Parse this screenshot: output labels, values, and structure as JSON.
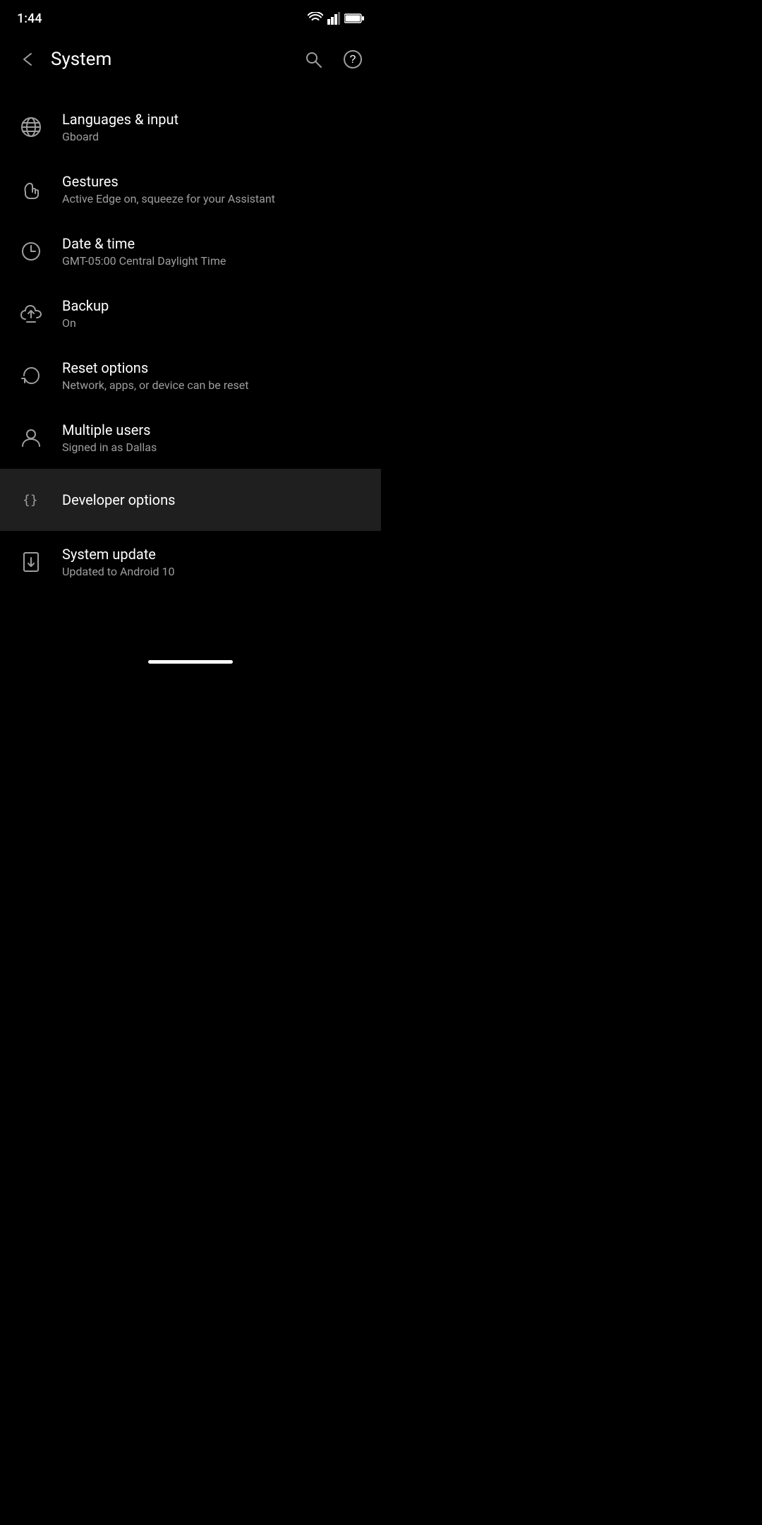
{
  "statusBar": {
    "time": "1:44",
    "wifi": "wifi",
    "signal": "signal",
    "battery": "battery"
  },
  "toolbar": {
    "title": "System",
    "backLabel": "back",
    "searchLabel": "search",
    "helpLabel": "help"
  },
  "menuItems": [
    {
      "id": "languages",
      "icon": "globe",
      "title": "Languages & input",
      "subtitle": "Gboard",
      "highlighted": false
    },
    {
      "id": "gestures",
      "icon": "gesture",
      "title": "Gestures",
      "subtitle": "Active Edge on, squeeze for your Assistant",
      "highlighted": false
    },
    {
      "id": "datetime",
      "icon": "clock",
      "title": "Date & time",
      "subtitle": "GMT-05:00 Central Daylight Time",
      "highlighted": false
    },
    {
      "id": "backup",
      "icon": "backup",
      "title": "Backup",
      "subtitle": "On",
      "highlighted": false
    },
    {
      "id": "reset",
      "icon": "reset",
      "title": "Reset options",
      "subtitle": "Network, apps, or device can be reset",
      "highlighted": false
    },
    {
      "id": "users",
      "icon": "user",
      "title": "Multiple users",
      "subtitle": "Signed in as Dallas",
      "highlighted": false
    },
    {
      "id": "developer",
      "icon": "code",
      "title": "Developer options",
      "subtitle": "",
      "highlighted": true
    },
    {
      "id": "update",
      "icon": "update",
      "title": "System update",
      "subtitle": "Updated to Android 10",
      "highlighted": false
    }
  ]
}
